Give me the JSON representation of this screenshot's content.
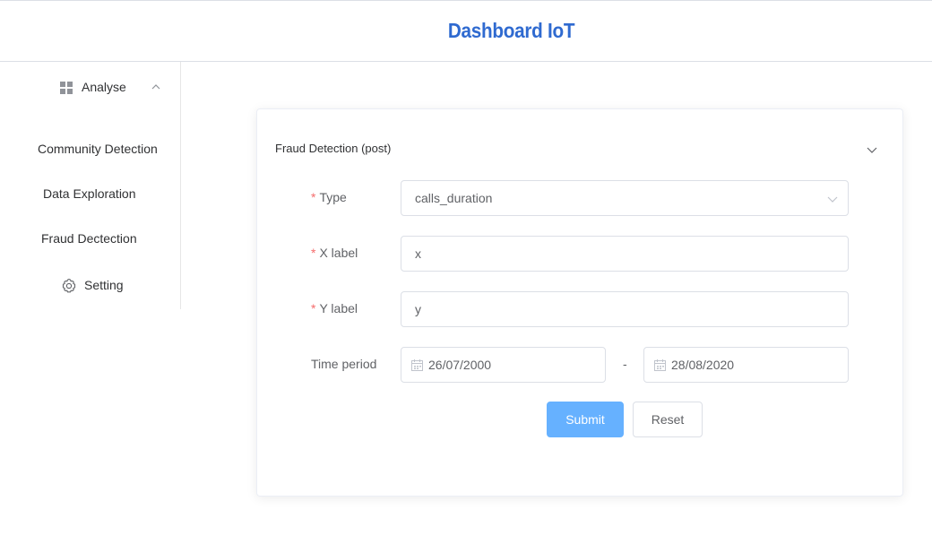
{
  "header": {
    "title": "Dashboard IoT"
  },
  "sidebar": {
    "group": {
      "label": "Analyse",
      "icon": "grid-icon"
    },
    "items": [
      {
        "label": "Community Detection"
      },
      {
        "label": "Data Exploration"
      },
      {
        "label": "Fraud Dectection"
      }
    ],
    "setting": {
      "label": "Setting",
      "icon": "gear-icon"
    }
  },
  "form": {
    "title": "Fraud Detection (post)",
    "required_mark": "*",
    "type": {
      "label": "Type",
      "value": "calls_duration"
    },
    "x_label": {
      "label": "X label",
      "value": "x"
    },
    "y_label": {
      "label": "Y label",
      "value": "y"
    },
    "time_period": {
      "label": "Time period",
      "start": "26/07/2000",
      "separator": "-",
      "end": "28/08/2020"
    },
    "submit_label": "Submit",
    "reset_label": "Reset"
  },
  "colors": {
    "title": "#2f6ad0",
    "primary_button": "#66b1ff",
    "required": "#f56c6c",
    "border": "#dcdfe6"
  }
}
